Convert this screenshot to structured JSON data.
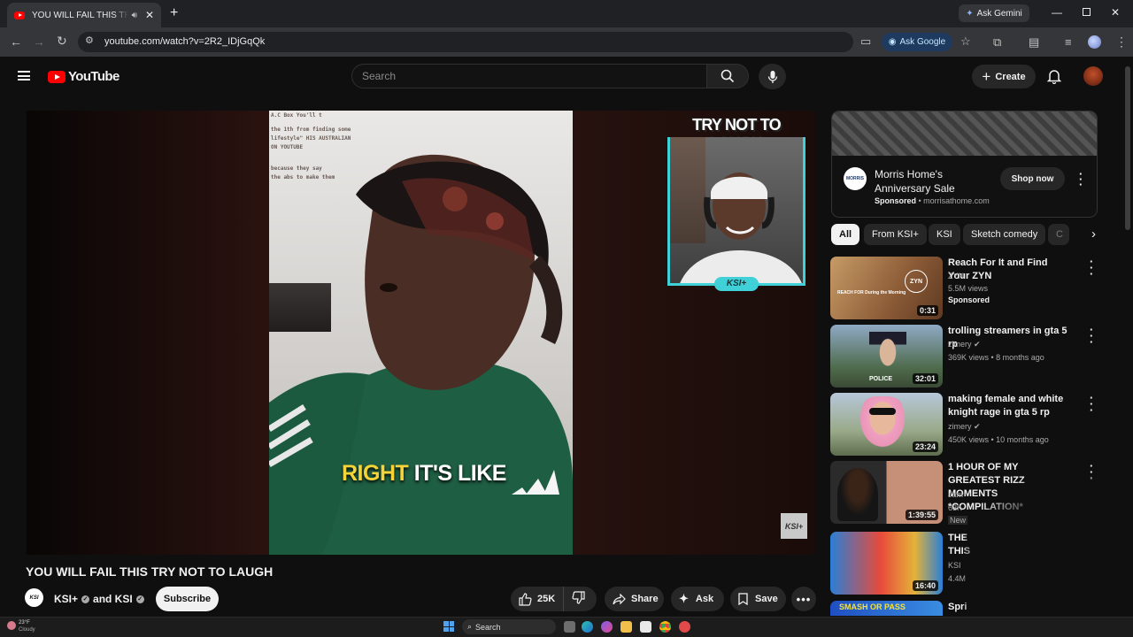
{
  "browser": {
    "tab_title": "YOU WILL FAIL THIS TRY NOT TO LAUGH",
    "new_tab": "+",
    "url": "youtube.com/watch?v=2R2_IDjGqQk",
    "ask_gemini": "Ask Gemini",
    "ask_google": "Ask Google"
  },
  "masthead": {
    "logo": "YouTube",
    "search_placeholder": "Search",
    "create_label": "Create"
  },
  "video": {
    "overlay_title": "TRY NOT TO LAUGH",
    "pip_logo": "KSI+",
    "caption_highlight": "RIGHT",
    "caption_rest": "IT'S LIKE",
    "watermark": "KSI+",
    "screen_text": [
      "A.C Box You'll t",
      "the 1th from finding some",
      "lifestyle\" HIS AUSTRALIAN",
      "ON YOUTUBE",
      "because they say",
      "the abs to make them"
    ]
  },
  "meta": {
    "title": "YOU WILL FAIL THIS TRY NOT TO LAUGH",
    "channel": "KSI+",
    "and_text": "and KSI",
    "subscribe": "Subscribe",
    "likes": "25K",
    "share": "Share",
    "ask": "Ask",
    "save": "Save"
  },
  "ad": {
    "advertiser": "Morris Home's Anniversary Sale",
    "sponsored": "Sponsored",
    "domain": "morrisathome.com",
    "cta": "Shop now",
    "logo_text": "MORRIS"
  },
  "chips": [
    "All",
    "From KSI+",
    "KSI",
    "Sketch comedy",
    "C"
  ],
  "recommendations": [
    {
      "title": "Reach For It and Find Your ZYN",
      "channel": "ZYN",
      "meta": "5.5M views",
      "extra": "Sponsored",
      "duration": "0:31",
      "thumb_text": "REACH FOR During the Morning",
      "badge": "ZYN",
      "verified": false
    },
    {
      "title": "trolling streamers in gta 5 rp",
      "channel": "zimery",
      "meta": "369K views • 8 months ago",
      "extra": "",
      "duration": "32:01",
      "thumb_text": "POLICE",
      "badge": "",
      "verified": true
    },
    {
      "title": "making female and white knight rage in gta 5 rp",
      "channel": "zimery",
      "meta": "450K views • 10 months ago",
      "extra": "",
      "duration": "23:24",
      "thumb_text": "",
      "badge": "",
      "verified": true
    },
    {
      "title": "1 HOUR OF MY GREATEST RIZZ MOMENTS *COMPILATION*",
      "channel": "Jam",
      "meta": "63K",
      "extra": "New",
      "duration": "1:39:55",
      "thumb_text": "",
      "badge": "",
      "verified": false
    },
    {
      "title": "THE THIS",
      "channel": "KSI",
      "meta": "4.4M",
      "extra": "",
      "duration": "16:40",
      "thumb_text": "",
      "badge": "",
      "verified": false
    },
    {
      "title": "Spri",
      "channel": "",
      "meta": "",
      "extra": "",
      "duration": "",
      "thumb_text": "SMASH OR PASS",
      "badge": "",
      "verified": false
    }
  ],
  "taskbar": {
    "temp": "23°F",
    "condition": "Cloudy",
    "search": "Search"
  },
  "colors": {
    "accent": "#ff0000",
    "chip_active": "#f1f1f1",
    "caption_yellow": "#f5d43a",
    "pip_cyan": "#3fd0d8"
  }
}
